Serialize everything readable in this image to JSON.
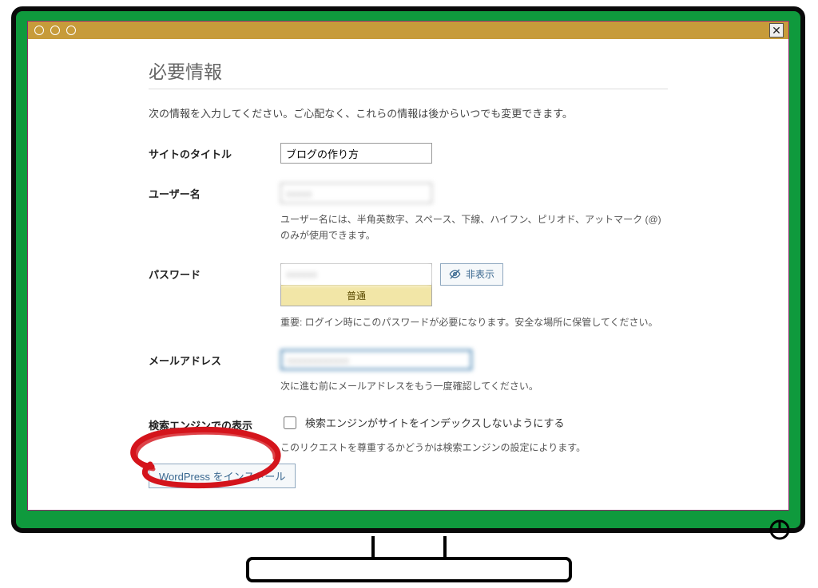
{
  "page": {
    "heading": "必要情報",
    "intro": "次の情報を入力してください。ご心配なく、これらの情報は後からいつでも変更できます。"
  },
  "labels": {
    "site_title": "サイトのタイトル",
    "username": "ユーザー名",
    "password": "パスワード",
    "email": "メールアドレス",
    "search_engine": "検索エンジンでの表示"
  },
  "values": {
    "site_title": "ブログの作り方",
    "username_masked": "xxxxx",
    "password_masked": "xxxxxx",
    "email_masked": "xxxxxxxxxxxx"
  },
  "hints": {
    "username": "ユーザー名には、半角英数字、スペース、下線、ハイフン、ピリオド、アットマーク (@) のみが使用できます。",
    "password_strength": "普通",
    "password_note": "重要: ログイン時にこのパスワードが必要になります。安全な場所に保管してください。",
    "email": "次に進む前にメールアドレスをもう一度確認してください。",
    "search_engine_checkbox": "検索エンジンがサイトをインデックスしないようにする",
    "search_engine_note": "このリクエストを尊重するかどうかは検索エンジンの設定によります。"
  },
  "buttons": {
    "hide_password": "非表示",
    "install": "WordPress をインストール"
  }
}
